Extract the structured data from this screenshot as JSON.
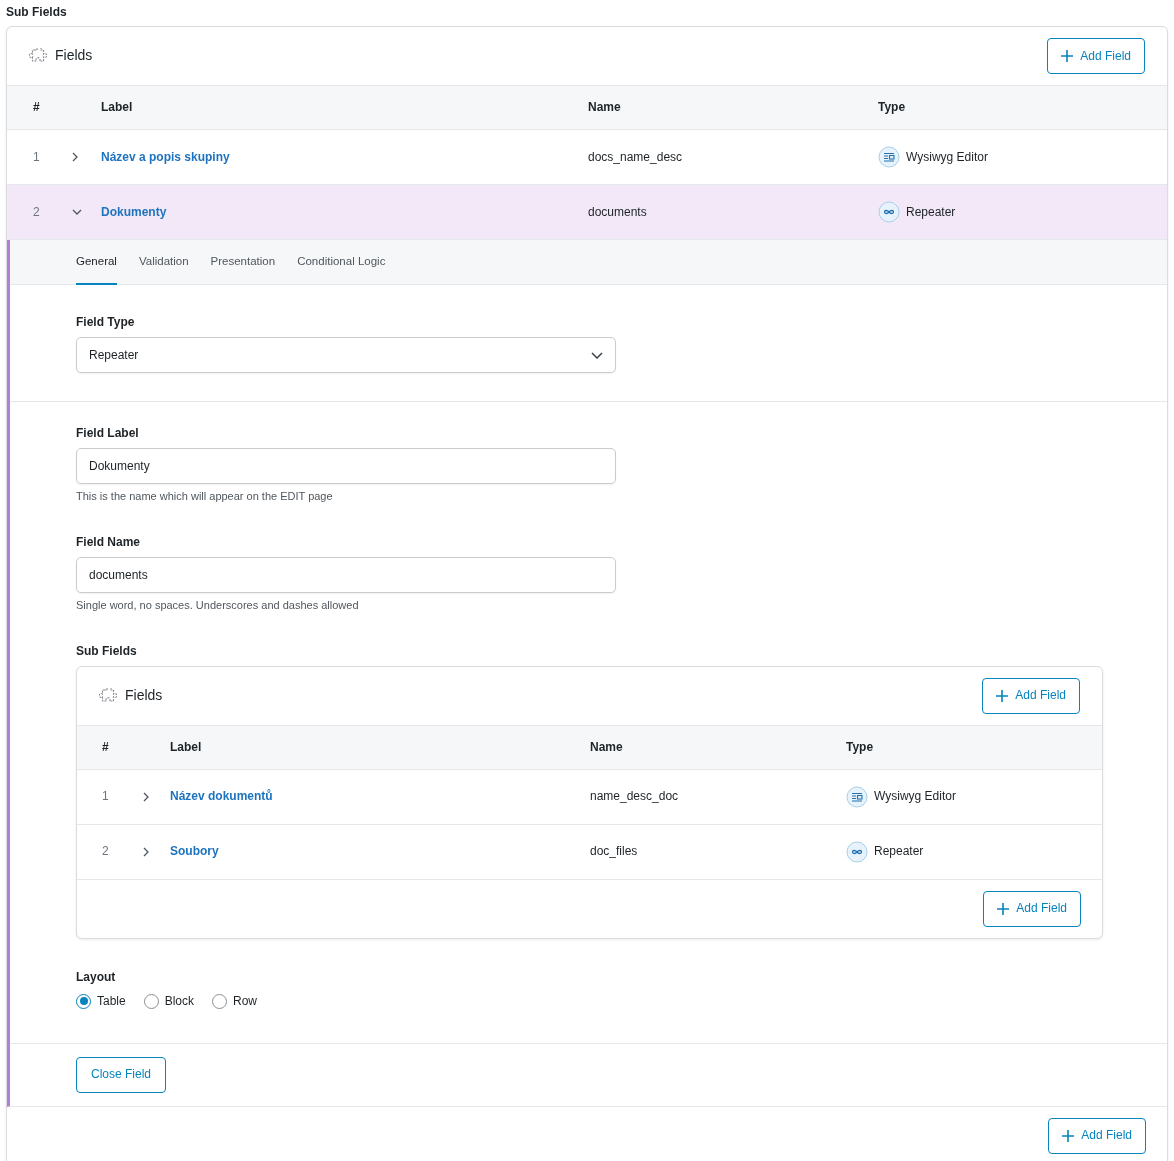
{
  "section_label": "Sub Fields",
  "fields": {
    "title": "Fields",
    "add_button": "Add Field",
    "columns": [
      "#",
      "Label",
      "Name",
      "Type"
    ],
    "rows": [
      {
        "number": "1",
        "label": "Název a popis skupiny",
        "name": "docs_name_desc",
        "type": {
          "kind": "wysiwyg",
          "label": "Wysiwyg Editor"
        },
        "expanded": false
      },
      {
        "number": "2",
        "label": "Dokumenty",
        "name": "documents",
        "type": {
          "kind": "repeater",
          "label": "Repeater"
        },
        "expanded": true
      }
    ],
    "footer_button": "Add Field"
  },
  "field_settings": {
    "tabs": [
      {
        "label": "General",
        "selected": true
      },
      {
        "label": "Validation",
        "selected": false
      },
      {
        "label": "Presentation",
        "selected": false
      },
      {
        "label": "Conditional Logic",
        "selected": false
      }
    ],
    "field_type": {
      "label": "Field Type",
      "value": "Repeater"
    },
    "field_label": {
      "label": "Field Label",
      "value": "Dokumenty",
      "help": "This is the name which will appear on the EDIT page"
    },
    "field_name": {
      "label": "Field Name",
      "value": "documents",
      "help": "Single word, no spaces. Underscores and dashes allowed"
    },
    "sub_fields": {
      "label": "Sub Fields",
      "title": "Fields",
      "add_button": "Add Field",
      "columns": [
        "#",
        "Label",
        "Name",
        "Type"
      ],
      "rows": [
        {
          "number": "1",
          "label": "Název dokumentů",
          "name": "name_desc_doc",
          "type": {
            "kind": "wysiwyg",
            "label": "Wysiwyg Editor"
          },
          "expanded": false
        },
        {
          "number": "2",
          "label": "Soubory",
          "name": "doc_files",
          "type": {
            "kind": "repeater",
            "label": "Repeater"
          },
          "expanded": false
        }
      ],
      "footer_button": "Add Field"
    },
    "layout": {
      "label": "Layout",
      "options": [
        {
          "label": "Table",
          "selected": true
        },
        {
          "label": "Block",
          "selected": false
        },
        {
          "label": "Row",
          "selected": false
        }
      ]
    },
    "close_button": "Close Field"
  }
}
